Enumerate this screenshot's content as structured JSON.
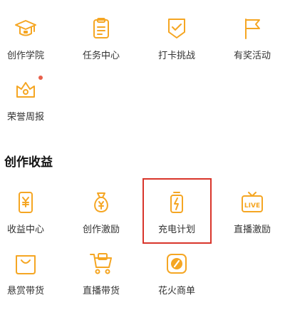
{
  "top_grid": [
    {
      "label": "创作学院",
      "icon": "graduation-cap-icon"
    },
    {
      "label": "任务中心",
      "icon": "clipboard-icon"
    },
    {
      "label": "打卡挑战",
      "icon": "badge-check-icon"
    },
    {
      "label": "有奖活动",
      "icon": "flag-icon"
    },
    {
      "label": "荣誉周报",
      "icon": "crown-icon",
      "badge": "red-dot"
    }
  ],
  "earnings_section": {
    "title": "创作收益",
    "items": [
      {
        "label": "收益中心",
        "icon": "yen-phone-icon"
      },
      {
        "label": "创作激励",
        "icon": "money-bag-icon"
      },
      {
        "label": "充电计划",
        "icon": "battery-bolt-icon",
        "highlighted": true
      },
      {
        "label": "直播激励",
        "icon": "live-tv-icon"
      },
      {
        "label": "悬赏带货",
        "icon": "shopping-bag-icon"
      },
      {
        "label": "直播带货",
        "icon": "shopping-cart-icon"
      },
      {
        "label": "花火商单",
        "icon": "spark-coin-icon"
      }
    ]
  },
  "colors": {
    "accent": "#f5a623",
    "highlight_border": "#d9352b",
    "dot": "#e8604c"
  }
}
